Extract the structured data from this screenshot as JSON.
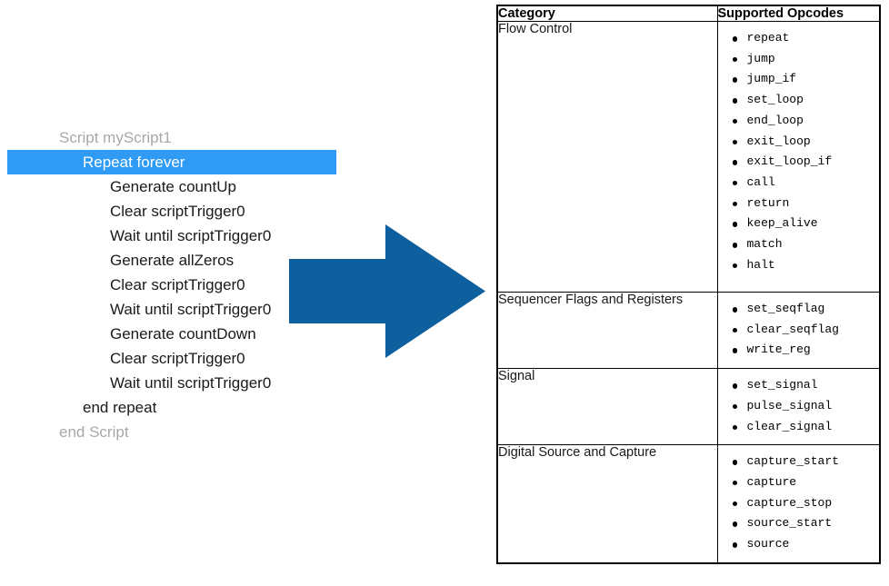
{
  "script_tree": {
    "lines": [
      {
        "text": "Script myScript1",
        "indent": 0,
        "style": "muted",
        "selected": false
      },
      {
        "text": "Repeat forever",
        "indent": 1,
        "style": "normal",
        "selected": true
      },
      {
        "text": "Generate countUp",
        "indent": 2,
        "style": "normal",
        "selected": false
      },
      {
        "text": "Clear scriptTrigger0",
        "indent": 2,
        "style": "normal",
        "selected": false
      },
      {
        "text": "Wait until scriptTrigger0",
        "indent": 2,
        "style": "normal",
        "selected": false
      },
      {
        "text": "Generate allZeros",
        "indent": 2,
        "style": "normal",
        "selected": false
      },
      {
        "text": "Clear scriptTrigger0",
        "indent": 2,
        "style": "normal",
        "selected": false
      },
      {
        "text": "Wait until scriptTrigger0",
        "indent": 2,
        "style": "normal",
        "selected": false
      },
      {
        "text": "Generate countDown",
        "indent": 2,
        "style": "normal",
        "selected": false
      },
      {
        "text": "Clear scriptTrigger0",
        "indent": 2,
        "style": "normal",
        "selected": false
      },
      {
        "text": "Wait until scriptTrigger0",
        "indent": 2,
        "style": "normal",
        "selected": false
      },
      {
        "text": "end repeat",
        "indent": 1,
        "style": "normal",
        "selected": false
      },
      {
        "text": "end Script",
        "indent": 0,
        "style": "muted",
        "selected": false
      }
    ]
  },
  "arrow": {
    "name": "right-arrow",
    "color": "#0d5f9e"
  },
  "opcode_table": {
    "headers": [
      "Category",
      "Supported Opcodes"
    ],
    "rows": [
      {
        "category": "Flow Control",
        "opcodes": [
          "repeat",
          "jump",
          "jump_if",
          "set_loop",
          "end_loop",
          "exit_loop",
          "exit_loop_if",
          "call",
          "return",
          "keep_alive",
          "match",
          "halt"
        ]
      },
      {
        "category": "Sequencer Flags and Registers",
        "opcodes": [
          "set_seqflag",
          "clear_seqflag",
          "write_reg"
        ]
      },
      {
        "category": "Signal",
        "opcodes": [
          "set_signal",
          "pulse_signal",
          "clear_signal"
        ]
      },
      {
        "category": "Digital Source and Capture",
        "opcodes": [
          "capture_start",
          "capture",
          "capture_stop",
          "source_start",
          "source"
        ]
      }
    ]
  },
  "colors": {
    "selection_blue": "#2f9bf5",
    "arrow_blue": "#0d5f9e",
    "muted_text": "#a8a8a8",
    "body_text": "#1a1a1a"
  }
}
